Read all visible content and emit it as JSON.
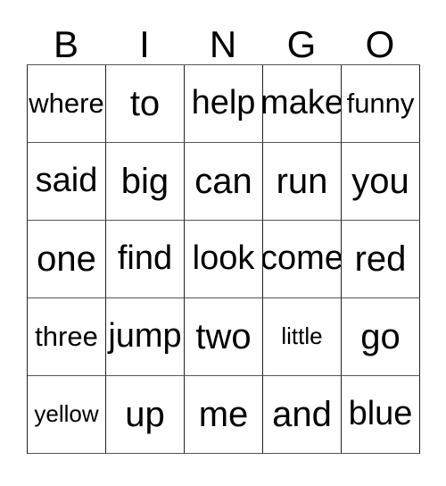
{
  "card": {
    "title": "BINGO",
    "headers": [
      "B",
      "I",
      "N",
      "G",
      "O"
    ],
    "rows": [
      {
        "cells": [
          "where",
          "to",
          "help",
          "make",
          "funny"
        ]
      },
      {
        "cells": [
          "said",
          "big",
          "can",
          "run",
          "you"
        ]
      },
      {
        "cells": [
          "one",
          "find",
          "look",
          "come",
          "red"
        ]
      },
      {
        "cells": [
          "three",
          "jump",
          "two",
          "little",
          "go"
        ]
      },
      {
        "cells": [
          "yellow",
          "up",
          "me",
          "and",
          "blue"
        ]
      }
    ],
    "colors": {
      "background": "#ffffff",
      "text": "#000000",
      "grid_line": "#222222",
      "grid_line_light": "#555555"
    }
  }
}
